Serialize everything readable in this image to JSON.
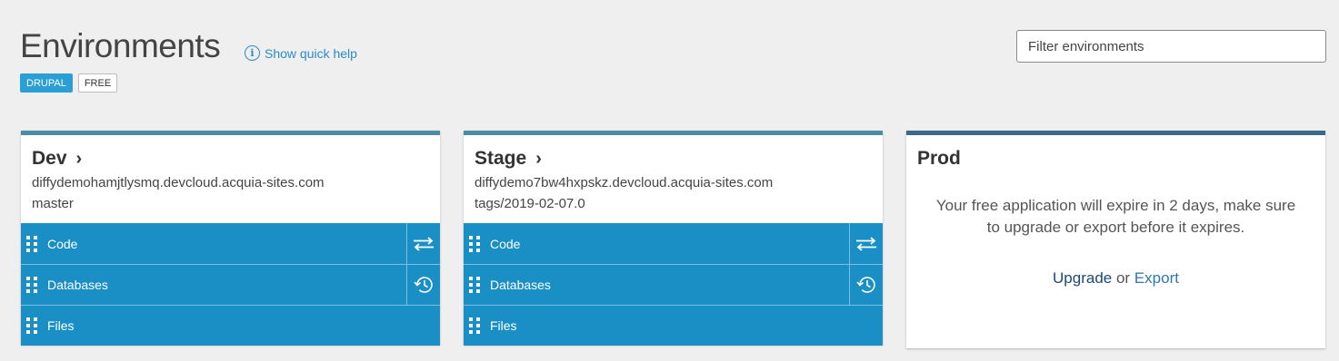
{
  "header": {
    "title": "Environments",
    "quick_help": "Show quick help",
    "info_glyph": "i"
  },
  "badges": [
    "DRUPAL",
    "FREE"
  ],
  "filter": {
    "placeholder": "Filter environments",
    "value": ""
  },
  "environments": [
    {
      "name": "Dev",
      "url": "diffydemohamjtlysmq.devcloud.acquia-sites.com",
      "branch": "master",
      "rows": [
        {
          "label": "Code",
          "action_icon": "transfer-arrows-icon"
        },
        {
          "label": "Databases",
          "action_icon": "history-icon"
        },
        {
          "label": "Files"
        }
      ]
    },
    {
      "name": "Stage",
      "url": "diffydemo7bw4hxpskz.devcloud.acquia-sites.com",
      "branch": "tags/2019-02-07.0",
      "rows": [
        {
          "label": "Code",
          "action_icon": "transfer-arrows-icon"
        },
        {
          "label": "Databases",
          "action_icon": "history-icon"
        },
        {
          "label": "Files"
        }
      ]
    }
  ],
  "prod": {
    "name": "Prod",
    "message": "Your free application will expire in 2 days, make sure to upgrade or export before it expires.",
    "upgrade_label": "Upgrade",
    "or_text": "or",
    "export_label": "Export"
  },
  "colors": {
    "background": "#efefef",
    "row_blue": "#1a8fc5",
    "card_top_border": "#4a8da3",
    "prod_top_border": "#3a6a8a",
    "link_blue": "#2a8bc9",
    "badge_drupal": "#2a9fd6"
  }
}
